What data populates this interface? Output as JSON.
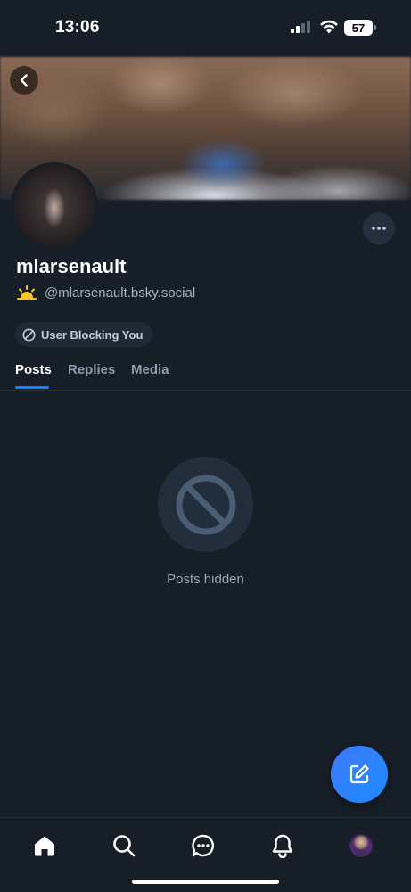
{
  "status_bar": {
    "time": "13:06",
    "battery_level": "57"
  },
  "profile": {
    "display_name": "mlarsenault",
    "handle": "@mlarsenault.bsky.social",
    "emoji": "🌤",
    "block_badge": "User Blocking You"
  },
  "tabs": [
    {
      "label": "Posts",
      "active": true
    },
    {
      "label": "Replies",
      "active": false
    },
    {
      "label": "Media",
      "active": false
    }
  ],
  "empty_state": {
    "icon": "no-entry-icon",
    "message": "Posts hidden"
  },
  "bottom_nav": {
    "items": [
      "home-icon",
      "search-icon",
      "chat-icon",
      "bell-icon",
      "profile-avatar"
    ]
  },
  "colors": {
    "background": "#161e27",
    "accent": "#1083fe",
    "fab": "#2f7fff"
  }
}
